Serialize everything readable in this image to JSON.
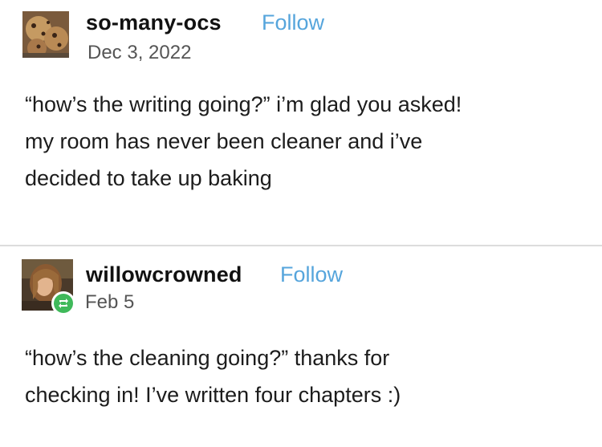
{
  "posts": [
    {
      "username": "so-many-ocs",
      "follow_label": "Follow",
      "date": "Dec 3, 2022",
      "avatar": "cookie-photo-avatar",
      "body_lines": [
        "“how’s the writing going?” i’m glad you asked!",
        "my room has never been cleaner and i’ve",
        "decided to take up baking"
      ]
    },
    {
      "username": "willowcrowned",
      "follow_label": "Follow",
      "date": "Feb 5",
      "avatar": "painted-portrait-avatar",
      "badge_icon": "reblog-icon",
      "body_lines": [
        "“how’s the cleaning going?” thanks for",
        "checking in! I’ve written four chapters :)"
      ]
    }
  ],
  "colors": {
    "follow": "#56a5dc",
    "username": "#111111",
    "date": "#555555",
    "reblog_badge": "#3fb95a",
    "divider": "#dcdcdc"
  }
}
